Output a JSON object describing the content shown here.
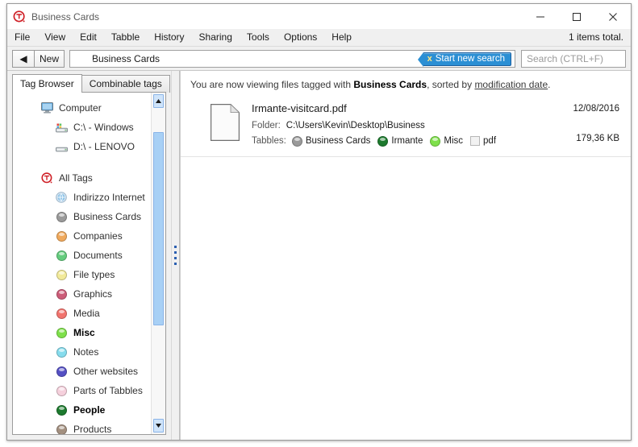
{
  "window": {
    "title": "Business Cards",
    "app_icon": "tabbles-logo-icon",
    "minimize_label": "—",
    "maximize_label": "□",
    "close_label": "×"
  },
  "menubar": {
    "items": [
      {
        "label": "File",
        "name": "menu-file"
      },
      {
        "label": "View",
        "name": "menu-view"
      },
      {
        "label": "Edit",
        "name": "menu-edit"
      },
      {
        "label": "Tabble",
        "name": "menu-tabble"
      },
      {
        "label": "History",
        "name": "menu-history"
      },
      {
        "label": "Sharing",
        "name": "menu-sharing"
      },
      {
        "label": "Tools",
        "name": "menu-tools"
      },
      {
        "label": "Options",
        "name": "menu-options"
      },
      {
        "label": "Help",
        "name": "menu-help"
      }
    ],
    "items_total": "1 items total."
  },
  "toolbar": {
    "back_label": "◀",
    "new_label": "New",
    "path_label": "Business Cards",
    "path_icon_color": "#8a8a8a",
    "new_search_x": "x",
    "new_search_label": "Start new search",
    "new_search_color": "#2b8fd4",
    "search_placeholder": "Search (CTRL+F)",
    "search_value": ""
  },
  "sidebar": {
    "tabs": [
      {
        "label": "Tag Browser",
        "name": "tab-tag-browser",
        "active": true
      },
      {
        "label": "Combinable tags",
        "name": "tab-combinable-tags",
        "active": false
      }
    ],
    "tree": [
      {
        "label": "Computer",
        "icon": "monitor-icon",
        "level": 0,
        "kind": "system",
        "bold": false
      },
      {
        "label": "C:\\ - Windows",
        "icon": "hard-drive-windows-icon",
        "level": 1,
        "kind": "drive",
        "bold": false
      },
      {
        "label": "D:\\ - LENOVO",
        "icon": "hard-drive-icon",
        "level": 1,
        "kind": "drive",
        "bold": false
      },
      {
        "label": "",
        "kind": "spacer"
      },
      {
        "label": "All Tags",
        "icon": "tabbles-logo-icon",
        "level": 0,
        "kind": "system",
        "bold": false
      },
      {
        "label": "Indirizzo Internet",
        "icon": "internet-tag-icon",
        "kind": "tag",
        "color": "#b9d6ea",
        "bold": false
      },
      {
        "label": "Business Cards",
        "icon": "tag-sphere-icon",
        "kind": "tag",
        "color": "#9a9a9a",
        "bold": false
      },
      {
        "label": "Companies",
        "icon": "tag-sphere-icon",
        "kind": "tag",
        "color": "#f0a95c",
        "bold": false
      },
      {
        "label": "Documents",
        "icon": "tag-sphere-icon",
        "kind": "tag",
        "color": "#64cc7e",
        "bold": false
      },
      {
        "label": "File types",
        "icon": "tag-sphere-icon",
        "kind": "tag",
        "color": "#f2ea9a",
        "bold": false
      },
      {
        "label": "Graphics",
        "icon": "tag-sphere-icon",
        "kind": "tag",
        "color": "#cc5c78",
        "bold": false
      },
      {
        "label": "Media",
        "icon": "tag-sphere-icon",
        "kind": "tag",
        "color": "#f2746e",
        "bold": false
      },
      {
        "label": "Misc",
        "icon": "tag-sphere-icon",
        "kind": "tag",
        "color": "#7ee04a",
        "bold": true
      },
      {
        "label": "Notes",
        "icon": "tag-sphere-icon",
        "kind": "tag",
        "color": "#86dced",
        "bold": false
      },
      {
        "label": "Other websites",
        "icon": "tag-sphere-icon",
        "kind": "tag",
        "color": "#5550c4",
        "bold": false
      },
      {
        "label": "Parts of Tabbles",
        "icon": "tag-sphere-icon",
        "kind": "tag",
        "color": "#f5d0dc",
        "bold": false
      },
      {
        "label": "People",
        "icon": "tag-sphere-icon",
        "kind": "tag",
        "color": "#1d7a2e",
        "bold": true
      },
      {
        "label": "Products",
        "icon": "tag-sphere-icon",
        "kind": "tag",
        "color": "#a39080",
        "bold": false
      }
    ],
    "scrollbar": {
      "up_arrow": "▲",
      "down_arrow": "▼",
      "thumb_color": "#a8d0f5"
    }
  },
  "main": {
    "info": {
      "prefix": "You are now viewing files tagged with ",
      "tag": "Business Cards",
      "middle": ", sorted by ",
      "sort": "modification date",
      "suffix": "."
    },
    "files": [
      {
        "name": "Irmante-visitcard.pdf",
        "icon": "document-page-icon",
        "folder_key": "Folder:",
        "folder_value": "C:\\Users\\Kevin\\Desktop\\Business",
        "tabbles_key": "Tabbles:",
        "tabbles": [
          {
            "label": "Business Cards",
            "color": "#9a9a9a",
            "shape": "sphere"
          },
          {
            "label": "Irmante",
            "color": "#1d7a2e",
            "shape": "sphere"
          },
          {
            "label": "Misc",
            "color": "#7ee04a",
            "shape": "sphere"
          },
          {
            "label": "pdf",
            "color": "#f2f2f2",
            "shape": "square"
          }
        ],
        "date": "12/08/2016",
        "size": "179,36 KB"
      }
    ]
  }
}
